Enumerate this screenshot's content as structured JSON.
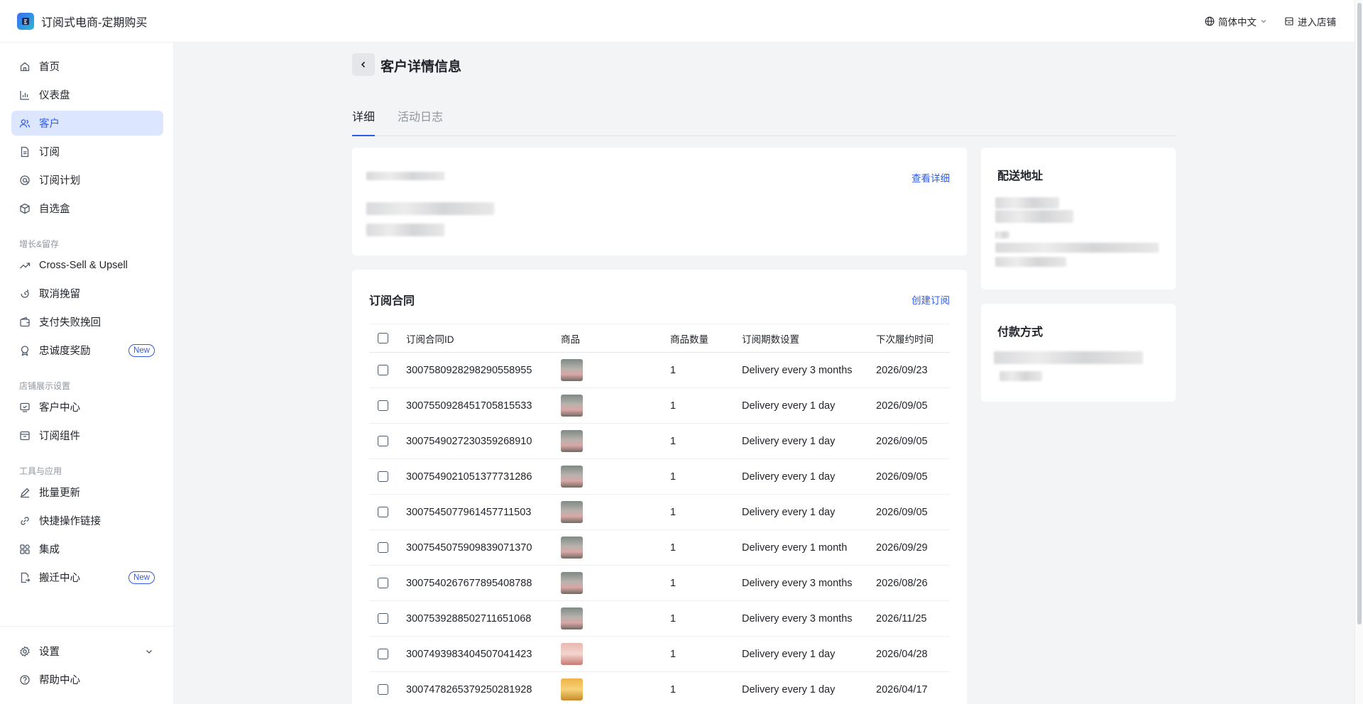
{
  "app": {
    "title": "订阅式电商-定期购买"
  },
  "topbar": {
    "language_label": "简体中文",
    "store_label": "进入店铺"
  },
  "sidebar": {
    "items": [
      {
        "label": "首页",
        "icon": "home-icon"
      },
      {
        "label": "仪表盘",
        "icon": "bar-chart-icon"
      },
      {
        "label": "客户",
        "icon": "users-icon"
      },
      {
        "label": "订阅",
        "icon": "document-icon"
      },
      {
        "label": "订阅计划",
        "icon": "plan-icon"
      },
      {
        "label": "自选盒",
        "icon": "box-icon"
      }
    ],
    "section_growth": "增长&留存",
    "growth_items": [
      {
        "label": "Cross-Sell & Upsell",
        "icon": "trending-up-icon"
      },
      {
        "label": "取消挽留",
        "icon": "refresh-icon"
      },
      {
        "label": "支付失败挽回",
        "icon": "wallet-icon"
      },
      {
        "label": "忠诚度奖励",
        "icon": "award-icon",
        "badge": "New"
      }
    ],
    "section_store": "店铺展示设置",
    "store_items": [
      {
        "label": "客户中心",
        "icon": "monitor-icon"
      },
      {
        "label": "订阅组件",
        "icon": "window-icon"
      }
    ],
    "section_tools": "工具与应用",
    "tool_items": [
      {
        "label": "批量更新",
        "icon": "edit-icon"
      },
      {
        "label": "快捷操作链接",
        "icon": "link-icon"
      },
      {
        "label": "集成",
        "icon": "apps-icon"
      },
      {
        "label": "搬迁中心",
        "icon": "migrate-icon",
        "badge": "New"
      }
    ],
    "bottom_items": [
      {
        "label": "设置",
        "icon": "gear-icon"
      },
      {
        "label": "帮助中心",
        "icon": "help-icon"
      }
    ]
  },
  "page": {
    "title": "客户详情信息",
    "tabs": [
      {
        "label": "详细"
      },
      {
        "label": "活动日志"
      }
    ]
  },
  "customer_card": {
    "view_details_label": "查看详细"
  },
  "contracts": {
    "title": "订阅合同",
    "create_label": "创建订阅",
    "columns": [
      "订阅合同ID",
      "商品",
      "商品数量",
      "订阅期数设置",
      "下次履约时间"
    ],
    "rows": [
      {
        "id": "3007580928298290558955",
        "qty": "1",
        "plan": "Delivery every 3 months",
        "next": "2026/09/23",
        "img": "a"
      },
      {
        "id": "3007550928451705815533",
        "qty": "1",
        "plan": "Delivery every 1 day",
        "next": "2026/09/05",
        "img": "a"
      },
      {
        "id": "3007549027230359268910",
        "qty": "1",
        "plan": "Delivery every 1 day",
        "next": "2026/09/05",
        "img": "a"
      },
      {
        "id": "3007549021051377731286",
        "qty": "1",
        "plan": "Delivery every 1 day",
        "next": "2026/09/05",
        "img": "a"
      },
      {
        "id": "3007545077961457711503",
        "qty": "1",
        "plan": "Delivery every 1 day",
        "next": "2026/09/05",
        "img": "a"
      },
      {
        "id": "3007545075909839071370",
        "qty": "1",
        "plan": "Delivery every 1 month",
        "next": "2026/09/29",
        "img": "a"
      },
      {
        "id": "3007540267677895408788",
        "qty": "1",
        "plan": "Delivery every 3 months",
        "next": "2026/08/26",
        "img": "a"
      },
      {
        "id": "3007539288502711651068",
        "qty": "1",
        "plan": "Delivery every 3 months",
        "next": "2026/11/25",
        "img": "a"
      },
      {
        "id": "3007493983404507041423",
        "qty": "1",
        "plan": "Delivery every 1 day",
        "next": "2026/04/28",
        "img": "b"
      },
      {
        "id": "3007478265379250281928",
        "qty": "1",
        "plan": "Delivery every 1 day",
        "next": "2026/04/17",
        "img": "c"
      }
    ]
  },
  "shipping": {
    "title": "配送地址"
  },
  "payment": {
    "title": "付款方式"
  },
  "colors": {
    "accent": "#2f5bea",
    "active_bg": "#dde6ff",
    "background": "#f3f4f6"
  }
}
